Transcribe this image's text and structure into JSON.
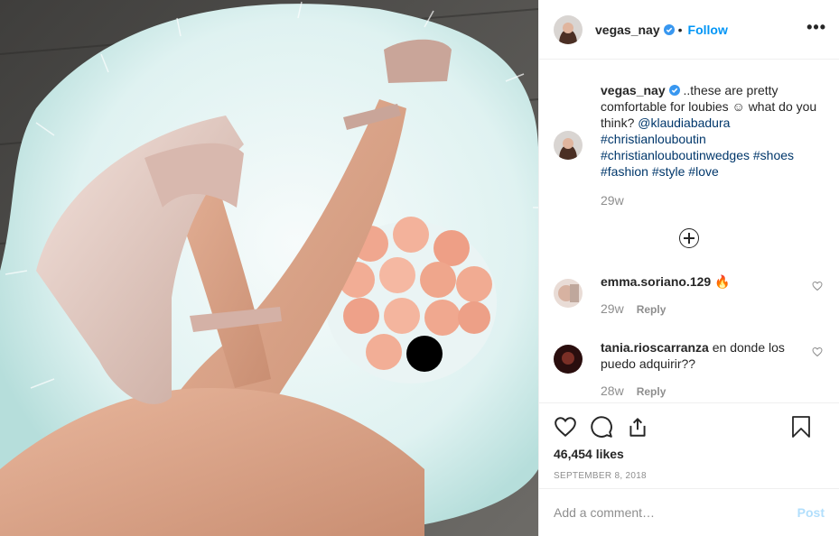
{
  "post": {
    "username": "vegas_nay",
    "follow_label": "Follow",
    "dot": "•",
    "more_label": "•••",
    "caption_text_lead": " ..these are pretty comfortable for loubies ☺ what do you think? ",
    "caption_mention": "@klaudiabadura",
    "caption_hashtags_1": "#christianlouboutin",
    "caption_hashtags_2": "#christianlouboutinwedges",
    "caption_hashtags_3": "#shoes",
    "caption_hashtags_4": "#fashion",
    "caption_hashtags_5": "#style",
    "caption_hashtags_6": "#love",
    "caption_age": "29w",
    "comments": [
      {
        "username": "emma.soriano.129",
        "text": " 🔥",
        "age": "29w",
        "reply": "Reply"
      },
      {
        "username": "tania.rioscarranza",
        "text": " en donde los puedo adquirir??",
        "age": "28w",
        "reply": "Reply"
      }
    ],
    "likes": "46,454 likes",
    "date": "SEPTEMBER 8, 2018",
    "add_comment_placeholder": "Add a comment…",
    "post_label": "Post"
  },
  "colors": {
    "accent": "#0095f6",
    "link": "#00376b",
    "muted": "#8e8e8e",
    "post_disabled": "#b2dffc"
  },
  "icons": [
    "verified-badge-icon",
    "more-options-icon",
    "load-more-icon",
    "heart-icon",
    "comment-icon",
    "share-icon",
    "bookmark-icon"
  ]
}
